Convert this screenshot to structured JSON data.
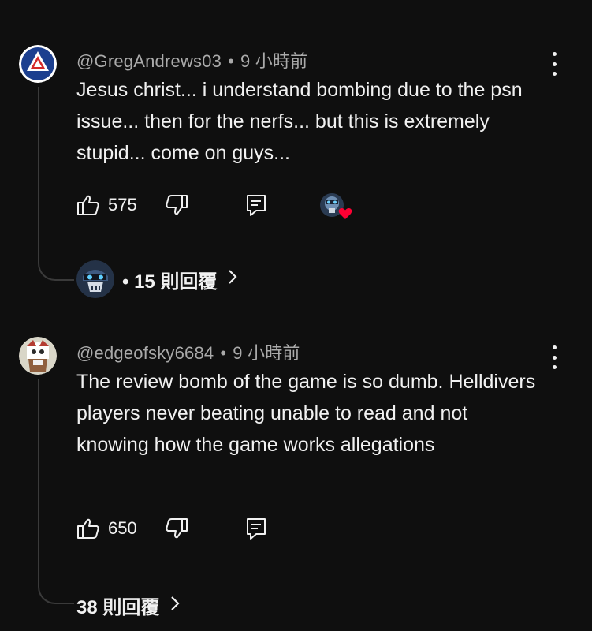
{
  "comments": [
    {
      "author": "@GregAndrews03",
      "time": "9 小時前",
      "text": "Jesus christ... i understand bombing due to the psn issue... then for the nerfs... but this is extremely stupid... come on guys...",
      "likes": "575",
      "replies_label": "• 15 則回覆"
    },
    {
      "author": "@edgeofsky6684",
      "time": "9 小時前",
      "text": "The review bomb of the game is so dumb. Helldivers players never beating unable to read and not knowing how the game works allegations",
      "likes": "650",
      "replies_label": "38 則回覆"
    }
  ],
  "ui": {
    "separator": "•",
    "chevron": "›",
    "accent_heart_color": "#ff0033",
    "text_color": "#f1f1f1",
    "meta_color": "#aaaaaa",
    "background": "#0f0f0f"
  },
  "icons": [
    "like-icon",
    "dislike-icon",
    "reply-icon",
    "more-vert-icon",
    "chevron-right-icon",
    "heart-icon"
  ]
}
